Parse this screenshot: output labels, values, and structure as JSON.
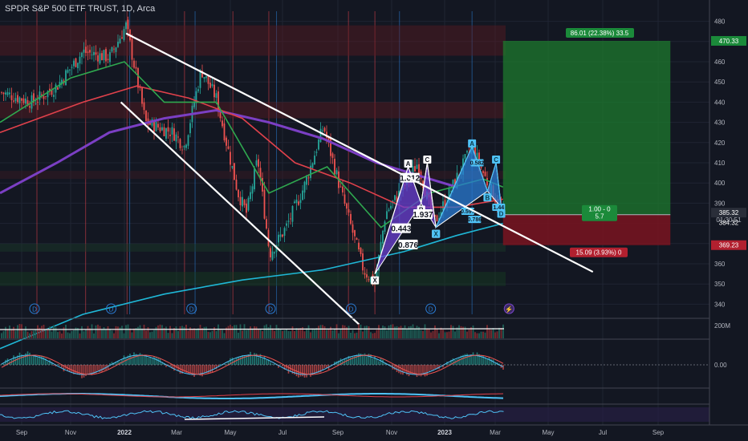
{
  "header": {
    "title": "SPDR S&P 500 ETF TRUST, 1D, Arca"
  },
  "colors": {
    "background": "#131722",
    "grid": "#1f2433",
    "up": "#26a69a",
    "down": "#ef5350",
    "ma_purple": "#7b3fc4",
    "ma_cyan": "#1fb7d6",
    "ma_red": "#e0414b",
    "ma_green": "#2fa84f",
    "target_green": "#1e7a2e",
    "stop_red": "#7a1420",
    "trendline": "#ffffff",
    "harmonic_fill_a": "#6b3fd1",
    "harmonic_fill_b": "#2a7bd3"
  },
  "chart_data": {
    "type": "line",
    "title": "SPDR S&P 500 ETF TRUST, 1D, Arca",
    "xlabel": "",
    "ylabel": "",
    "x_ticks": [
      "Sep",
      "Nov",
      "2022",
      "Mar",
      "May",
      "Jul",
      "Sep",
      "Nov",
      "2023",
      "Mar",
      "May",
      "Jul",
      "Sep"
    ],
    "y_ticks": [
      480,
      470,
      460,
      450,
      440,
      430,
      420,
      410,
      400,
      390,
      380,
      370,
      360,
      350,
      340
    ],
    "ylim": [
      335,
      485
    ],
    "grid": true,
    "series": [
      {
        "key": "price",
        "x": [
          "2021-08-15",
          "2021-09-15",
          "2021-10-15",
          "2021-11-15",
          "2021-12-15",
          "2022-01-03",
          "2022-01-25",
          "2022-02-25",
          "2022-03-10",
          "2022-03-29",
          "2022-04-15",
          "2022-05-10",
          "2022-05-20",
          "2022-06-02",
          "2022-06-16",
          "2022-07-05",
          "2022-07-25",
          "2022-08-16",
          "2022-09-05",
          "2022-09-30",
          "2022-10-13",
          "2022-10-25",
          "2022-11-15",
          "2022-12-01",
          "2022-12-20",
          "2023-01-10",
          "2023-02-02",
          "2023-02-20",
          "2023-03-10"
        ],
        "y": [
          445,
          440,
          448,
          465,
          462,
          478,
          430,
          425,
          418,
          456,
          442,
          395,
          385,
          412,
          365,
          378,
          398,
          428,
          395,
          357,
          350,
          385,
          398,
          410,
          380,
          398,
          418,
          400,
          385
        ]
      },
      {
        "key": "ma_long_purple",
        "x": [
          "2021-08-15",
          "2021-10-15",
          "2021-12-15",
          "2022-02-15",
          "2022-04-15",
          "2022-06-15",
          "2022-08-15",
          "2022-10-15",
          "2022-12-15",
          "2023-01-15"
        ],
        "y": [
          395,
          410,
          425,
          432,
          436,
          430,
          422,
          410,
          402,
          398
        ]
      },
      {
        "key": "ma_long_cyan",
        "x": [
          "2021-08-15",
          "2021-11-15",
          "2022-02-15",
          "2022-05-15",
          "2022-08-15",
          "2022-11-15",
          "2023-01-15",
          "2023-03-10"
        ],
        "y": [
          318,
          335,
          345,
          352,
          357,
          366,
          374,
          380
        ]
      },
      {
        "key": "ma_mid_red",
        "x": [
          "2021-08-15",
          "2021-11-15",
          "2022-01-15",
          "2022-03-15",
          "2022-05-15",
          "2022-07-15",
          "2022-09-15",
          "2022-11-15",
          "2023-01-15",
          "2023-03-10"
        ],
        "y": [
          425,
          440,
          448,
          442,
          432,
          410,
          400,
          388,
          388,
          392
        ]
      },
      {
        "key": "ma_short_green",
        "x": [
          "2021-08-15",
          "2021-11-01",
          "2022-01-01",
          "2022-02-15",
          "2022-04-15",
          "2022-06-15",
          "2022-08-20",
          "2022-10-20",
          "2022-12-15",
          "2023-02-15",
          "2023-03-10"
        ],
        "y": [
          430,
          452,
          460,
          440,
          440,
          395,
          408,
          378,
          395,
          402,
          398
        ]
      }
    ],
    "trendlines": [
      {
        "x": [
          "2022-01-03",
          "2023-06-20"
        ],
        "y": [
          474,
          356
        ]
      },
      {
        "x": [
          "2021-12-28",
          "2022-09-25"
        ],
        "y": [
          440,
          330
        ]
      }
    ],
    "patterns": [
      {
        "labels": [
          "X",
          "A",
          "B",
          "C",
          "D"
        ],
        "x": [
          "2022-10-13",
          "2022-11-20",
          "2022-12-05",
          "2022-12-12",
          "2022-12-22"
        ],
        "y": [
          355,
          408,
          390,
          410,
          378
        ]
      },
      {
        "labels": [
          "X",
          "A",
          "B",
          "C",
          "D"
        ],
        "x": [
          "2022-12-22",
          "2023-02-02",
          "2023-02-20",
          "2023-03-02",
          "2023-03-08"
        ],
        "y": [
          378,
          418,
          396,
          410,
          388
        ]
      }
    ],
    "pattern_ratios": [
      "1.012",
      "0.443",
      "1.937",
      "0.876",
      "0.582",
      "0.597",
      "0.786",
      "1.44"
    ],
    "position": {
      "entry": 384.32,
      "target": 470.33,
      "stop": 369.23,
      "x_start": "2023-03-10",
      "x_end": "2023-09-15"
    },
    "price_labels": [
      {
        "value": 470.33,
        "text": "470.33",
        "kind": "target"
      },
      {
        "value": 385.32,
        "text": "385.32",
        "kind": "current"
      },
      {
        "value": 384.32,
        "text": "384.32",
        "kind": "entry"
      },
      {
        "value": 369.23,
        "text": "369.23",
        "kind": "stop"
      }
    ],
    "countdown": "01:30:51",
    "target_box_text": "86.01 (22.38%) 33.5",
    "stop_box_text": "15.09 (3.93%) 0",
    "risk_reward_text": [
      "1.00 - 0",
      "5.7"
    ],
    "dividend_markers": [
      "D",
      "D",
      "D",
      "D",
      "D",
      "D",
      "D"
    ],
    "volume_axis_label": "200M",
    "oscillator_axis_label": "0.00"
  }
}
